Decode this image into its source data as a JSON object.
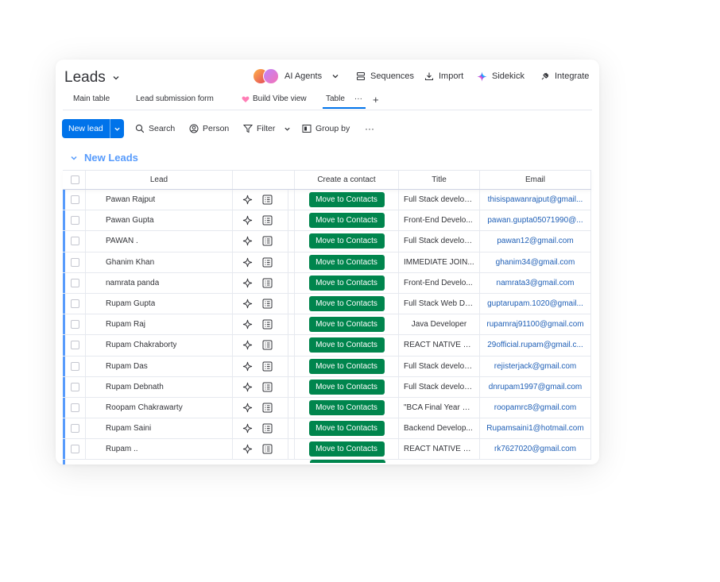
{
  "header": {
    "title": "Leads",
    "actions": {
      "ai_agents": "AI Agents",
      "sequences": "Sequences",
      "import": "Import",
      "sidekick": "Sidekick",
      "integrate": "Integrate"
    }
  },
  "tabs": [
    {
      "label": "Main table"
    },
    {
      "label": "Lead submission form"
    },
    {
      "label": "Build Vibe view"
    },
    {
      "label": "Table"
    }
  ],
  "toolbar": {
    "new_lead": "New lead",
    "search": "Search",
    "person": "Person",
    "filter": "Filter",
    "group_by": "Group by"
  },
  "group": {
    "name": "New Leads",
    "color": "#579bfc"
  },
  "table": {
    "columns": {
      "lead": "Lead",
      "create_contact": "Create a contact",
      "title": "Title",
      "email": "Email"
    },
    "button_label": "Move to Contacts",
    "button_color": "#00854d",
    "rows": [
      {
        "lead": "Pawan Rajput",
        "title": "Full Stack develop...",
        "email": "thisispawanrajput@gmail..."
      },
      {
        "lead": "Pawan Gupta",
        "title": "Front-End Develo...",
        "email": "pawan.gupta05071990@..."
      },
      {
        "lead": "PAWAN .",
        "title": "Full Stack develop...",
        "email": "pawan12@gmail.com"
      },
      {
        "lead": "Ghanim Khan",
        "title": "IMMEDIATE JOIN...",
        "email": "ghanim34@gmail.com"
      },
      {
        "lead": "namrata panda",
        "title": "Front-End Develo...",
        "email": "namrata3@gmail.com"
      },
      {
        "lead": "Rupam Gupta",
        "title": "Full Stack Web De...",
        "email": "guptarupam.1020@gmail..."
      },
      {
        "lead": "Rupam Raj",
        "title": "Java Developer",
        "email": "rupamraj91100@gmail.com"
      },
      {
        "lead": "Rupam Chakraborty",
        "title": "REACT NATIVE D...",
        "email": "29official.rupam@gmail.c..."
      },
      {
        "lead": "Rupam Das",
        "title": "Full Stack develop...",
        "email": "rejisterjack@gmail.com"
      },
      {
        "lead": "Rupam Debnath",
        "title": "Full Stack develop...",
        "email": "dnrupam1997@gmail.com"
      },
      {
        "lead": "Roopam Chakrawarty",
        "title": "\"BCA Final Year St...",
        "email": "roopamrc8@gmail.com"
      },
      {
        "lead": "Rupam Saini",
        "title": "Backend Develop...",
        "email": "Rupamsaini1@hotmail.com"
      },
      {
        "lead": "Rupam ..",
        "title": "REACT NATIVE D...",
        "email": "rk7627020@gmail.com"
      }
    ]
  },
  "colors": {
    "accent": "#0073ea",
    "link": "#1f5fb6"
  }
}
